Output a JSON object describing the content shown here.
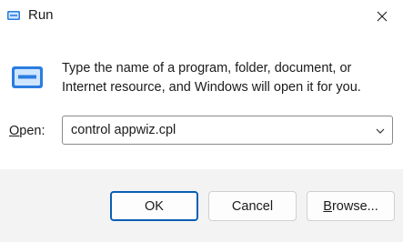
{
  "window": {
    "title": "Run"
  },
  "content": {
    "description": "Type the name of a program, folder, document, or Internet resource, and Windows will open it for you.",
    "open_label_mnemonic": "O",
    "open_label_rest": "pen:",
    "open_value": "control appwiz.cpl"
  },
  "buttons": {
    "ok_label": "OK",
    "cancel_label": "Cancel",
    "browse_mnemonic": "B",
    "browse_rest": "rowse..."
  },
  "icons": {
    "title_icon": "run-icon",
    "dialog_icon": "run-icon",
    "close_icon": "close-icon",
    "dropdown_icon": "chevron-down-icon"
  },
  "colors": {
    "accent": "#0a5fb4",
    "icon_blue": "#2b7de0"
  }
}
